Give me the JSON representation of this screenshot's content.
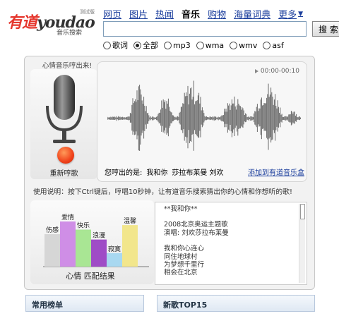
{
  "logo": {
    "cn": "有道",
    "en": "youdao",
    "beta": "测试版",
    "sub": "音乐搜索"
  },
  "nav": {
    "items": [
      "网页",
      "图片",
      "热闻",
      "音乐",
      "购物",
      "海量词典",
      "更多"
    ],
    "active": "音乐"
  },
  "search": {
    "value": "",
    "button_label": "搜 索"
  },
  "filters": [
    {
      "label": "歌词",
      "checked": false
    },
    {
      "label": "全部",
      "checked": true
    },
    {
      "label": "mp3",
      "checked": false
    },
    {
      "label": "wma",
      "checked": false
    },
    {
      "label": "wmv",
      "checked": false
    },
    {
      "label": "asf",
      "checked": false
    }
  ],
  "hum": {
    "heading": "心情音乐哼出来!",
    "record_label": "重新哼歌",
    "timer": "00:00-00:10",
    "hummed_label": "您哼出的是:",
    "song_title": "我和你",
    "artist": "莎拉布莱曼 刘欢",
    "add_link": "添加到有道音乐盒",
    "instructions": "使用说明：按下Ctrl键后，哼唱10秒钟，让有道音乐搜索猜出你的心情和你想听的歌!"
  },
  "mood": {
    "caption": "心情 匹配结果",
    "bars": [
      {
        "label": "伤感",
        "value": 0.72,
        "color": "#d6d6d6"
      },
      {
        "label": "爱情",
        "value": 1.0,
        "color": "#cf8ee6"
      },
      {
        "label": "快乐",
        "value": 0.82,
        "color": "#a9e694"
      },
      {
        "label": "浪漫",
        "value": 0.6,
        "color": "#9f4cc6"
      },
      {
        "label": "寂寞",
        "value": 0.3,
        "color": "#a8d8f0"
      },
      {
        "label": "温馨",
        "value": 0.92,
        "color": "#f2e68c"
      }
    ]
  },
  "lyrics": {
    "header": "**我和你**",
    "lines_a": [
      "2008北京奥运主题歌",
      "演唱: 刘欢莎拉布莱曼"
    ],
    "lines_b": [
      "我和你心连心",
      "同住地球村",
      "为梦想千里行",
      "相会在北京"
    ]
  },
  "bottom_tabs": {
    "left": "常用榜单",
    "right": "新歌TOP15"
  }
}
